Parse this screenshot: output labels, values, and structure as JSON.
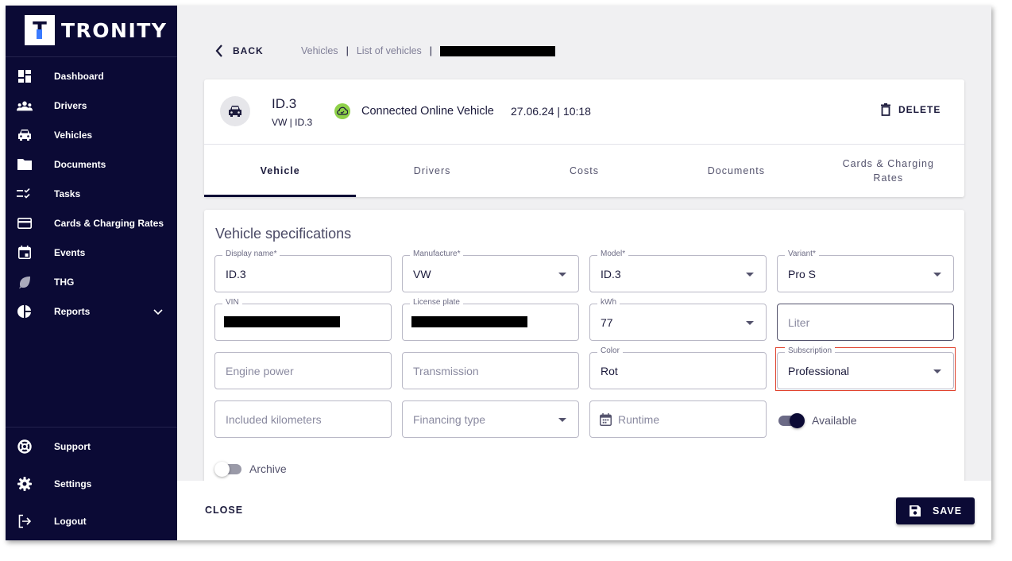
{
  "brand": {
    "logo_letter": "T",
    "name": "TRONITY"
  },
  "sidebar": {
    "items": [
      {
        "label": "Dashboard",
        "icon": "dashboard-icon"
      },
      {
        "label": "Drivers",
        "icon": "people-icon"
      },
      {
        "label": "Vehicles",
        "icon": "car-icon"
      },
      {
        "label": "Documents",
        "icon": "folder-icon"
      },
      {
        "label": "Tasks",
        "icon": "checklist-icon"
      },
      {
        "label": "Cards & Charging Rates",
        "icon": "credit-card-icon"
      },
      {
        "label": "Events",
        "icon": "calendar-icon"
      },
      {
        "label": "THG",
        "icon": "leaf-icon"
      },
      {
        "label": "Reports",
        "icon": "pie-chart-icon"
      }
    ],
    "bottom": [
      {
        "label": "Support",
        "icon": "lifebuoy-icon"
      },
      {
        "label": "Settings",
        "icon": "gear-icon"
      },
      {
        "label": "Logout",
        "icon": "logout-icon"
      }
    ]
  },
  "topbar": {
    "back_label": "BACK",
    "breadcrumb": [
      "Vehicles",
      "List of vehicles"
    ],
    "separator": "|"
  },
  "vehicle": {
    "name": "ID.3",
    "subtitle": "VW | ID.3",
    "status": "Connected Online Vehicle",
    "timestamp": "27.06.24 | 10:18",
    "delete_label": "DELETE"
  },
  "tabs": [
    {
      "label": "Vehicle",
      "active": true
    },
    {
      "label": "Drivers",
      "active": false
    },
    {
      "label": "Costs",
      "active": false
    },
    {
      "label": "Documents",
      "active": false
    },
    {
      "label": "Cards & Charging Rates",
      "active": false
    }
  ],
  "specs": {
    "title": "Vehicle specifications",
    "fields": {
      "display_name": {
        "label": "Display name*",
        "value": "ID.3"
      },
      "manufacture": {
        "label": "Manufacture*",
        "value": "VW"
      },
      "model": {
        "label": "Model*",
        "value": "ID.3"
      },
      "variant": {
        "label": "Variant*",
        "value": "Pro S"
      },
      "vin": {
        "label": "VIN",
        "value": ""
      },
      "license_plate": {
        "label": "License plate",
        "value": ""
      },
      "kwh": {
        "label": "kWh",
        "value": "77"
      },
      "liter": {
        "placeholder": "Liter"
      },
      "engine_power": {
        "placeholder": "Engine power"
      },
      "transmission": {
        "placeholder": "Transmission"
      },
      "color": {
        "label": "Color",
        "value": "Rot"
      },
      "subscription": {
        "label": "Subscription",
        "value": "Professional"
      },
      "included_km": {
        "placeholder": "Included kilometers"
      },
      "financing_type": {
        "placeholder": "Financing type"
      },
      "runtime": {
        "placeholder": "Runtime"
      }
    },
    "available": {
      "label": "Available",
      "on": true
    },
    "archive": {
      "label": "Archive",
      "on": false
    }
  },
  "footer": {
    "close_label": "CLOSE",
    "save_label": "SAVE"
  },
  "colors": {
    "sidebar_bg": "#0b0a35",
    "accent": "#0b0a35",
    "online": "#8fd14a",
    "highlight": "#e0422d"
  }
}
